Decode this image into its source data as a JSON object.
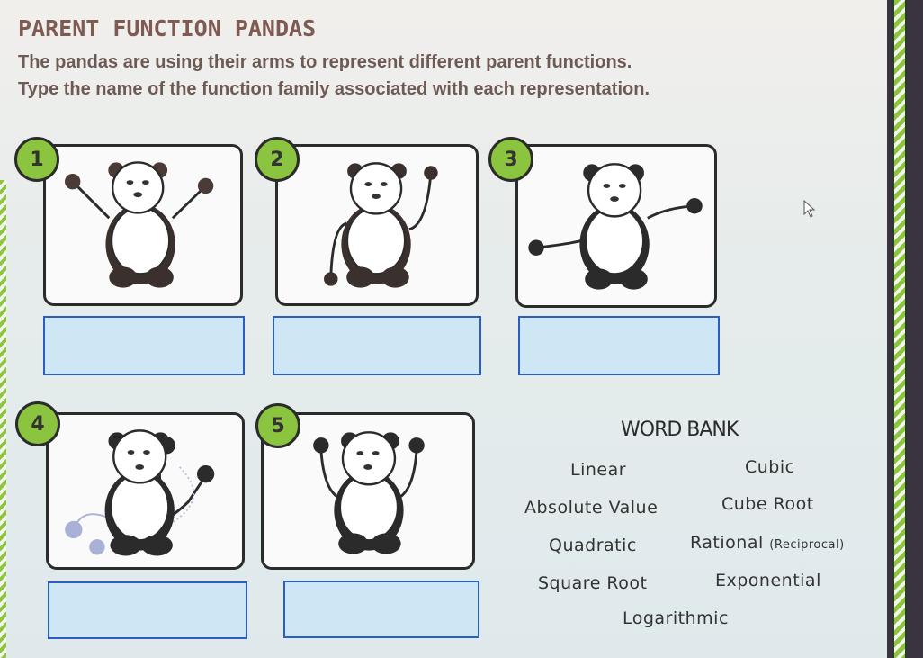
{
  "header": {
    "title": "PARENT FUNCTION PANDAS",
    "instruction_1": "The pandas are using their arms to represent different parent functions.",
    "instruction_2": "Type the name of the function family associated with each representation."
  },
  "pandas": [
    {
      "number": "1",
      "pose": "arms raised diagonally (V shape)",
      "answer": "",
      "placeholder": ""
    },
    {
      "number": "2",
      "pose": "left arm curving down, right arm curving up",
      "answer": "",
      "placeholder": ""
    },
    {
      "number": "3",
      "pose": "left arm low flat, right arm high flat",
      "answer": "",
      "placeholder": ""
    },
    {
      "number": "4",
      "pose": "arm curving up steeply, faded alternate arm positions",
      "answer": "",
      "placeholder": ""
    },
    {
      "number": "5",
      "pose": "both arms raised straight up (U shape)",
      "answer": "",
      "placeholder": ""
    }
  ],
  "word_bank": {
    "title": "WORD BANK",
    "items": [
      {
        "label": "Linear",
        "note": ""
      },
      {
        "label": "Cubic",
        "note": ""
      },
      {
        "label": "Absolute Value",
        "note": ""
      },
      {
        "label": "Cube Root",
        "note": ""
      },
      {
        "label": "Quadratic",
        "note": ""
      },
      {
        "label": "Rational",
        "note": "(Reciprocal)"
      },
      {
        "label": "Square Root",
        "note": ""
      },
      {
        "label": "Exponential",
        "note": ""
      },
      {
        "label": "Logarithmic",
        "note": ""
      }
    ]
  },
  "colors": {
    "badge_green": "#8bc53f",
    "answer_fill": "#cfe6f4",
    "answer_border": "#2a5ec4",
    "title_brown": "#7e5a52"
  }
}
